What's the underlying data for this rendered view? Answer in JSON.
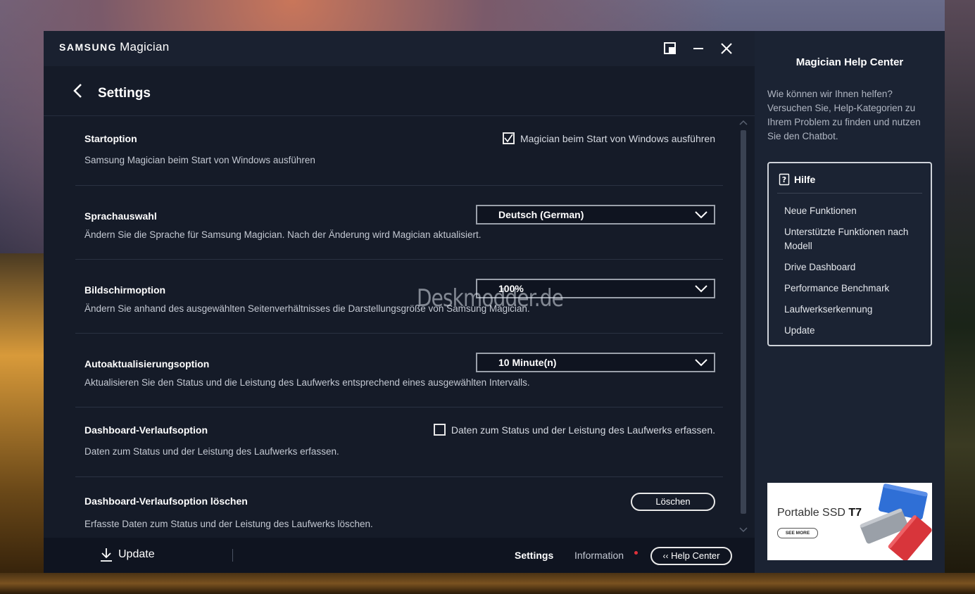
{
  "app": {
    "brand_bold": "SAMSUNG",
    "brand_name": "Magician"
  },
  "header": {
    "title": "Settings"
  },
  "settings": {
    "startoption": {
      "title": "Startoption",
      "description": "Samsung Magician beim Start von Windows ausführen",
      "checkbox_label": "Magician beim Start von Windows ausführen",
      "checked": true
    },
    "sprachauswahl": {
      "title": "Sprachauswahl",
      "description": "Ändern Sie die Sprache für Samsung Magician. Nach der Änderung wird Magician aktualisiert.",
      "selected": "Deutsch (German)"
    },
    "bildschirmoption": {
      "title": "Bildschirmoption",
      "description": "Ändern Sie anhand des ausgewählten Seitenverhältnisses die Darstellungsgröße von Samsung Magician.",
      "selected": "100%"
    },
    "autoaktualisierung": {
      "title": "Autoaktualisierungsoption",
      "description": "Aktualisieren Sie den Status und die Leistung des Laufwerks entsprechend eines ausgewählten Intervalls.",
      "selected": "10 Minute(n)"
    },
    "dashboard_verlauf": {
      "title": "Dashboard-Verlaufsoption",
      "description": "Daten zum Status und der Leistung des Laufwerks erfassen.",
      "checkbox_label": "Daten zum Status und der Leistung des Laufwerks erfassen.",
      "checked": false
    },
    "dashboard_loeschen": {
      "title": "Dashboard-Verlaufsoption löschen",
      "description": "Erfasste Daten zum Status und der Leistung des Laufwerks löschen.",
      "button_label": "Löschen"
    }
  },
  "watermark": "Deskmodder.de",
  "footer": {
    "update_label": "Update",
    "settings_label": "Settings",
    "information_label": "Information",
    "help_center_label": "Help Center"
  },
  "help": {
    "title": "Magician Help Center",
    "intro": "Wie können wir Ihnen helfen? Versuchen Sie, Help-Kategorien zu Ihrem Problem zu finden und nutzen Sie den Chatbot.",
    "box_title": "Hilfe",
    "links": [
      "Neue Funktionen",
      "Unterstützte Funktionen nach Modell",
      "Drive Dashboard",
      "Performance Benchmark",
      "Laufwerkserkennung",
      "Update"
    ]
  },
  "ad": {
    "title_regular": "Portable SSD ",
    "title_bold": "T7",
    "button_label": "SEE MORE",
    "colors": [
      "#2f6fd6",
      "#9aa0a8",
      "#d8353b"
    ]
  },
  "colors": {
    "window_bg": "#151b28",
    "titlebar_bg": "#1a2130",
    "help_bg": "#1b2333",
    "notification_dot": "#e0313a"
  },
  "icons": {
    "restore": "restore-icon",
    "minimize": "minimize-icon",
    "close": "close-icon",
    "back": "chevron-left-icon",
    "dropdown": "chevron-down-icon",
    "download": "download-icon",
    "help": "question-book-icon"
  }
}
